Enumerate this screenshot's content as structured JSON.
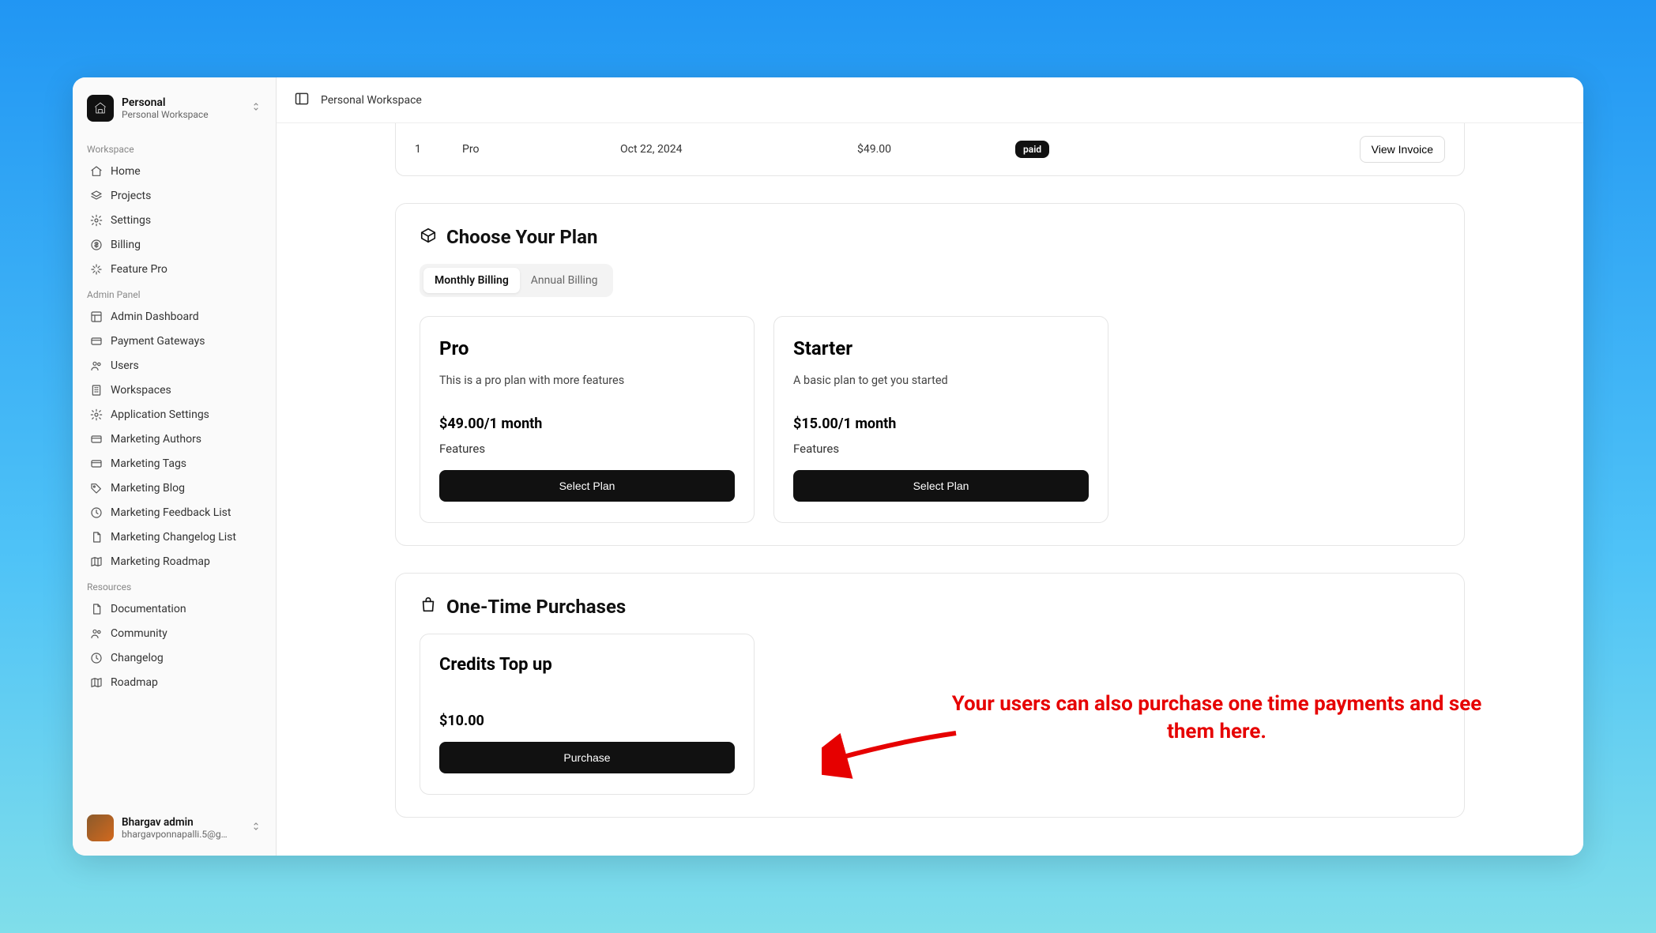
{
  "workspace": {
    "name": "Personal",
    "subtitle": "Personal Workspace"
  },
  "sidebar": {
    "sections": [
      {
        "label": "Workspace",
        "items": [
          {
            "label": "Home",
            "icon": "home"
          },
          {
            "label": "Projects",
            "icon": "layers"
          },
          {
            "label": "Settings",
            "icon": "gear"
          },
          {
            "label": "Billing",
            "icon": "dollar"
          },
          {
            "label": "Feature Pro",
            "icon": "sparkle"
          }
        ]
      },
      {
        "label": "Admin Panel",
        "items": [
          {
            "label": "Admin Dashboard",
            "icon": "layout"
          },
          {
            "label": "Payment Gateways",
            "icon": "card"
          },
          {
            "label": "Users",
            "icon": "users"
          },
          {
            "label": "Workspaces",
            "icon": "building"
          },
          {
            "label": "Application Settings",
            "icon": "gear"
          },
          {
            "label": "Marketing Authors",
            "icon": "card"
          },
          {
            "label": "Marketing Tags",
            "icon": "card"
          },
          {
            "label": "Marketing Blog",
            "icon": "tag"
          },
          {
            "label": "Marketing Feedback List",
            "icon": "clock"
          },
          {
            "label": "Marketing Changelog List",
            "icon": "doc"
          },
          {
            "label": "Marketing Roadmap",
            "icon": "map"
          }
        ]
      },
      {
        "label": "Resources",
        "items": [
          {
            "label": "Documentation",
            "icon": "doc"
          },
          {
            "label": "Community",
            "icon": "users"
          },
          {
            "label": "Changelog",
            "icon": "clock"
          },
          {
            "label": "Roadmap",
            "icon": "map"
          }
        ]
      }
    ]
  },
  "user": {
    "name": "Bhargav admin",
    "email": "bhargavponnapalli.5@g…"
  },
  "topbar": {
    "breadcrumb": "Personal Workspace"
  },
  "invoice_row": {
    "num": "1",
    "plan": "Pro",
    "date": "Oct 22, 2024",
    "amount": "$49.00",
    "status": "paid",
    "action": "View Invoice"
  },
  "choose_plan": {
    "title": "Choose Your Plan",
    "toggle": {
      "monthly": "Monthly Billing",
      "annual": "Annual Billing"
    },
    "plans": [
      {
        "name": "Pro",
        "desc": "This is a pro plan with more features",
        "price": "$49.00/1 month",
        "features_label": "Features",
        "button": "Select Plan"
      },
      {
        "name": "Starter",
        "desc": "A basic plan to get you started",
        "price": "$15.00/1 month",
        "features_label": "Features",
        "button": "Select Plan"
      }
    ]
  },
  "one_time": {
    "title": "One-Time Purchases",
    "items": [
      {
        "name": "Credits Top up",
        "price": "$10.00",
        "button": "Purchase"
      }
    ]
  },
  "annotation": {
    "text": "Your users can also purchase one time payments and see them here."
  }
}
